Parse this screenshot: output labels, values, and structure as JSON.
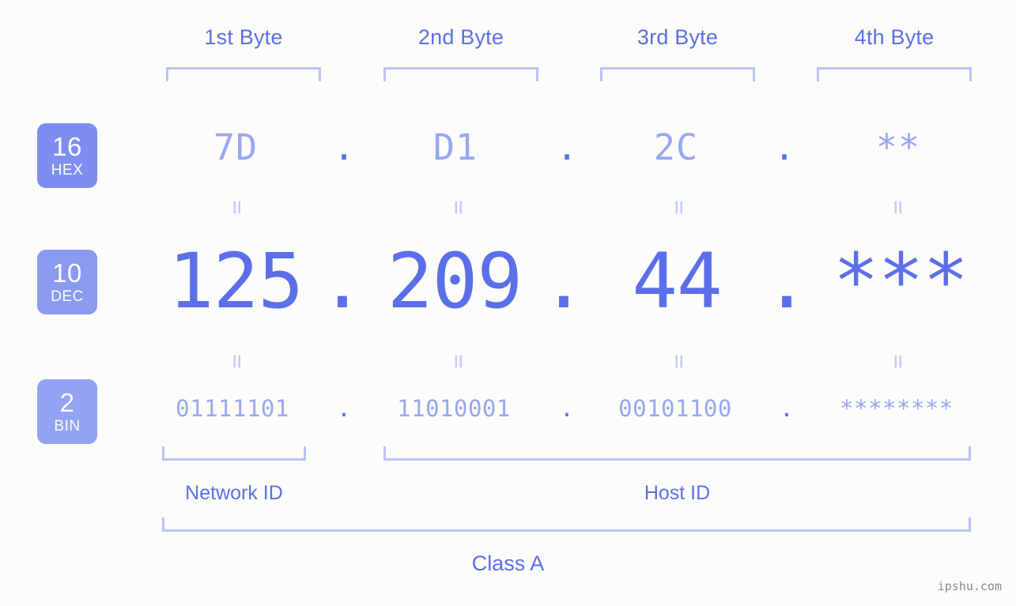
{
  "background_color": "#fcfdfa",
  "accent_color": "#5b6fe8",
  "accent_light_color": "#98a6f2",
  "bracket_color": "#b9c3f7",
  "byte_headers": [
    {
      "label": "1st Byte"
    },
    {
      "label": "2nd Byte"
    },
    {
      "label": "3rd Byte"
    },
    {
      "label": "4th Byte"
    }
  ],
  "bases": [
    {
      "number": "16",
      "name": "HEX",
      "color": "#7e8ef0"
    },
    {
      "number": "10",
      "name": "DEC",
      "color": "#8a9af1"
    },
    {
      "number": "2",
      "name": "BIN",
      "color": "#93a2f2"
    }
  ],
  "rows": {
    "hex": {
      "values": [
        "7D",
        "D1",
        "2C",
        "**"
      ],
      "separator": "."
    },
    "dec": {
      "values": [
        "125",
        "209",
        "44",
        "***"
      ],
      "separator": "."
    },
    "bin": {
      "values": [
        "01111101",
        "11010001",
        "00101100",
        "********"
      ],
      "separator": "."
    }
  },
  "equals_glyph": "=",
  "sections": [
    {
      "label": "Network ID"
    },
    {
      "label": "Host ID"
    }
  ],
  "class_label": "Class A",
  "watermark": "ipshu.com"
}
